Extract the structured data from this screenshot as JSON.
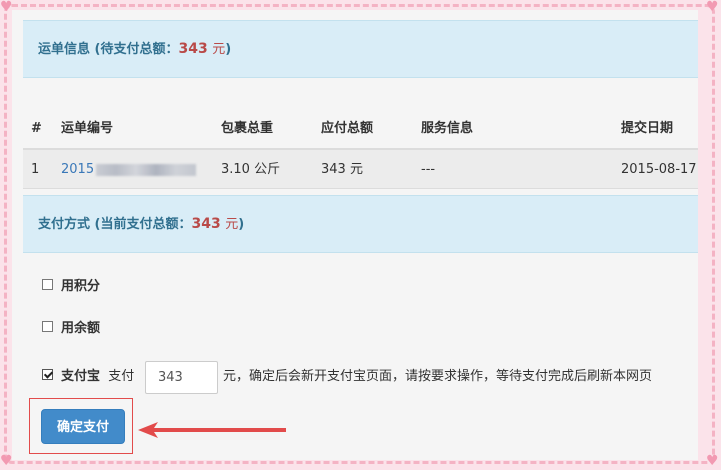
{
  "waybill_info": {
    "title_prefix": "运单信息 (待支付总额：",
    "amount": "343",
    "unit": "元",
    "title_suffix": ")"
  },
  "table": {
    "headers": [
      "#",
      "运单编号",
      "包裹总重",
      "应付总额",
      "服务信息",
      "提交日期"
    ],
    "rows": [
      {
        "index": "1",
        "waybill_no_visible": "2015",
        "weight": "3.10 公斤",
        "amount": "343 元",
        "service": "---",
        "date": "2015-08-17"
      }
    ]
  },
  "payment_method": {
    "title_prefix": "支付方式 (当前支付总额：",
    "amount": "343",
    "unit": "元",
    "title_suffix": ")"
  },
  "options": {
    "points_label": "用积分",
    "balance_label": "用余额",
    "alipay_label": "支付宝",
    "pay_prefix": "支付",
    "pay_amount": "343",
    "pay_suffix": "元，确定后会新开支付宝页面，请按要求操作，等待支付完成后刷新本网页"
  },
  "confirm_button": "确定支付",
  "colors": {
    "info_bg": "#d9edf7",
    "info_text": "#31708f",
    "amount_red": "#b94a48",
    "button_blue": "#428bca",
    "arrow_red": "#e24b4b",
    "frame_pink": "#f4b3c4"
  }
}
